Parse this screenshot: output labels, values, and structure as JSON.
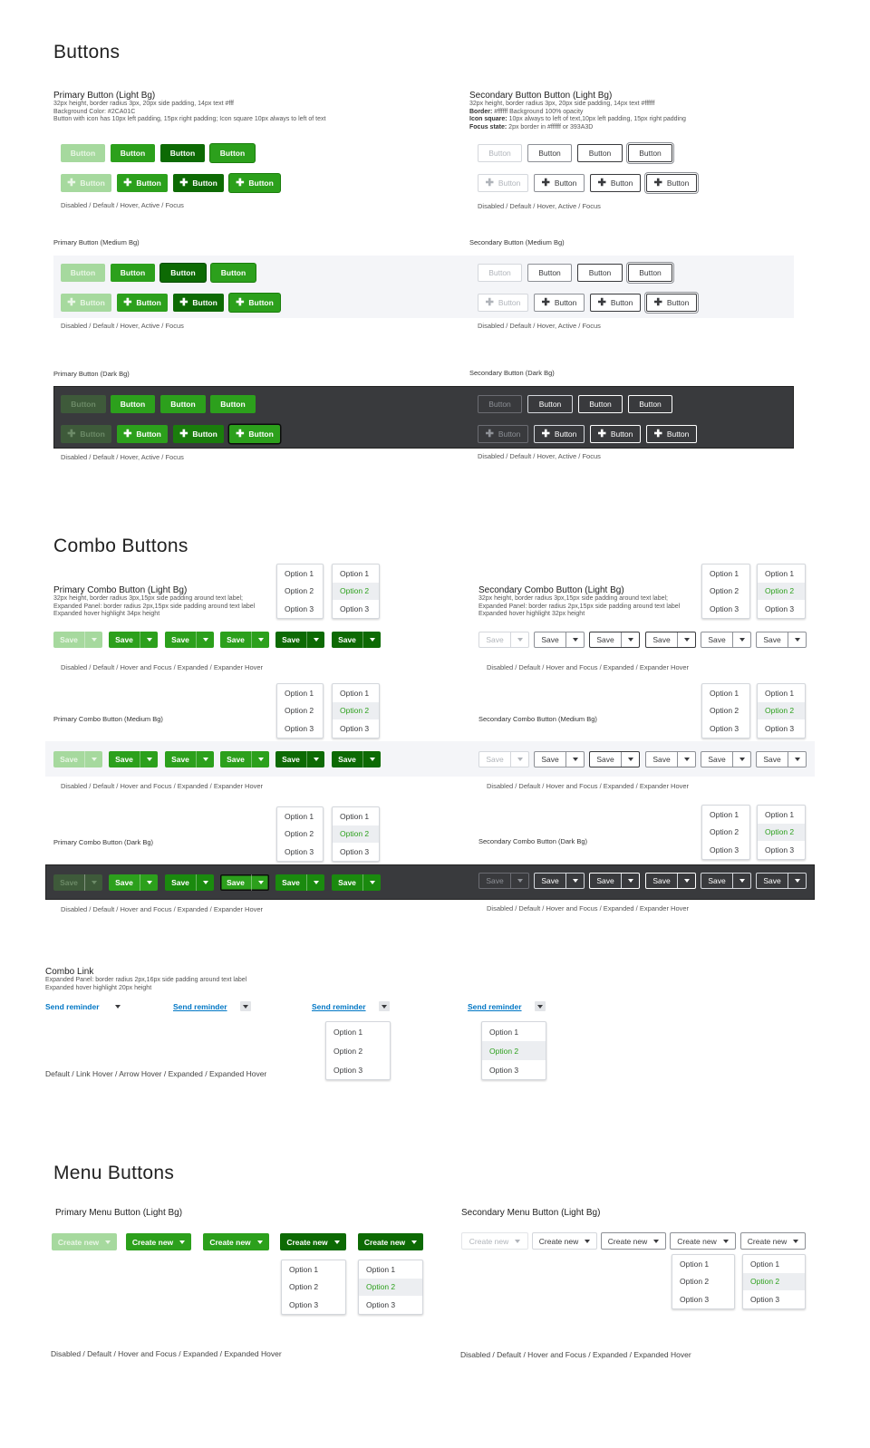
{
  "sections": {
    "buttons": "Buttons",
    "combo": "Combo Buttons",
    "menu": "Menu Buttons"
  },
  "buttons": {
    "primary_light": {
      "title": "Primary Button (Light Bg)",
      "spec1": "32px height, border radius 3px, 20px side padding, 14px text #fff",
      "spec2": "Background Color: #2CA01C",
      "spec3": "Button with icon has 10px left padding, 15px right padding; Icon square 10px always to left of text"
    },
    "secondary_light": {
      "title": "Secondary Button Button (Light Bg)",
      "spec1": "32px height, border radius 3px, 20px side padding, 14px text #ffffff",
      "spec2_label": "Border:",
      "spec2": " #ffffff Background 100% opacity",
      "spec3_label": "Icon square:",
      "spec3": " 10px always to left of text,10px left padding, 15px right padding",
      "spec4_label": "Focus state:",
      "spec4": " 2px border in #ffffff or 393A3D"
    },
    "primary_medium_title": "Primary Button (Medium Bg)",
    "secondary_medium_title": "Secondary Button (Medium Bg)",
    "primary_dark_title": "Primary Button (Dark Bg)",
    "secondary_dark_title": "Secondary Button (Dark Bg)",
    "label": "Button",
    "plus": "✚",
    "caption": "Disabled / Default / Hover, Active / Focus"
  },
  "combo": {
    "primary_light": {
      "title": "Primary Combo Button (Light Bg)",
      "spec1": "32px height, border radius 3px,15px side padding around text label;",
      "spec2": "Expanded Panel: border radius 2px,15px side padding around text label",
      "spec3": "Expanded hover highlight 34px height"
    },
    "secondary_light": {
      "title": "Secondary Combo Button (Light Bg)",
      "spec1": "32px height, border radius 3px,15px side padding around text label;",
      "spec2": "Expanded Panel: border radius 2px,15px side padding around text label",
      "spec3": "Expanded hover highlight 32px height"
    },
    "primary_medium_title": "Primary Combo Button (Medium Bg)",
    "secondary_medium_title": "Secondary Combo Button (Medium Bg)",
    "primary_dark_title": "Primary Combo Button (Dark Bg)",
    "secondary_dark_title": "Secondary Combo Button (Dark Bg)",
    "save": "Save",
    "caption": "Disabled / Default / Hover and Focus / Expanded / Expander Hover",
    "options": [
      "Option 1",
      "Option 2",
      "Option 3"
    ]
  },
  "combo_link": {
    "title": "Combo Link",
    "spec1": "Expanded Panel: border radius 2px,16px side padding around text label",
    "spec2": "Expanded hover highlight 20px height",
    "link": "Send reminder",
    "caption": "Default / Link Hover / Arrow Hover / Expanded / Expanded Hover"
  },
  "menu": {
    "primary_title": "Primary Menu Button (Light Bg)",
    "secondary_title": "Secondary Menu Button (Light Bg)",
    "label": "Create new",
    "caption": "Disabled / Default / Hover and Focus / Expanded / Expanded Hover"
  },
  "colors": {
    "brand_green": "#2CA01C",
    "hover_green": "#1A7D0C",
    "active_green": "#0D6A04",
    "dark_bg": "#393A3D",
    "medium_bg": "#F4F5F8",
    "link_blue": "#0077C5"
  }
}
